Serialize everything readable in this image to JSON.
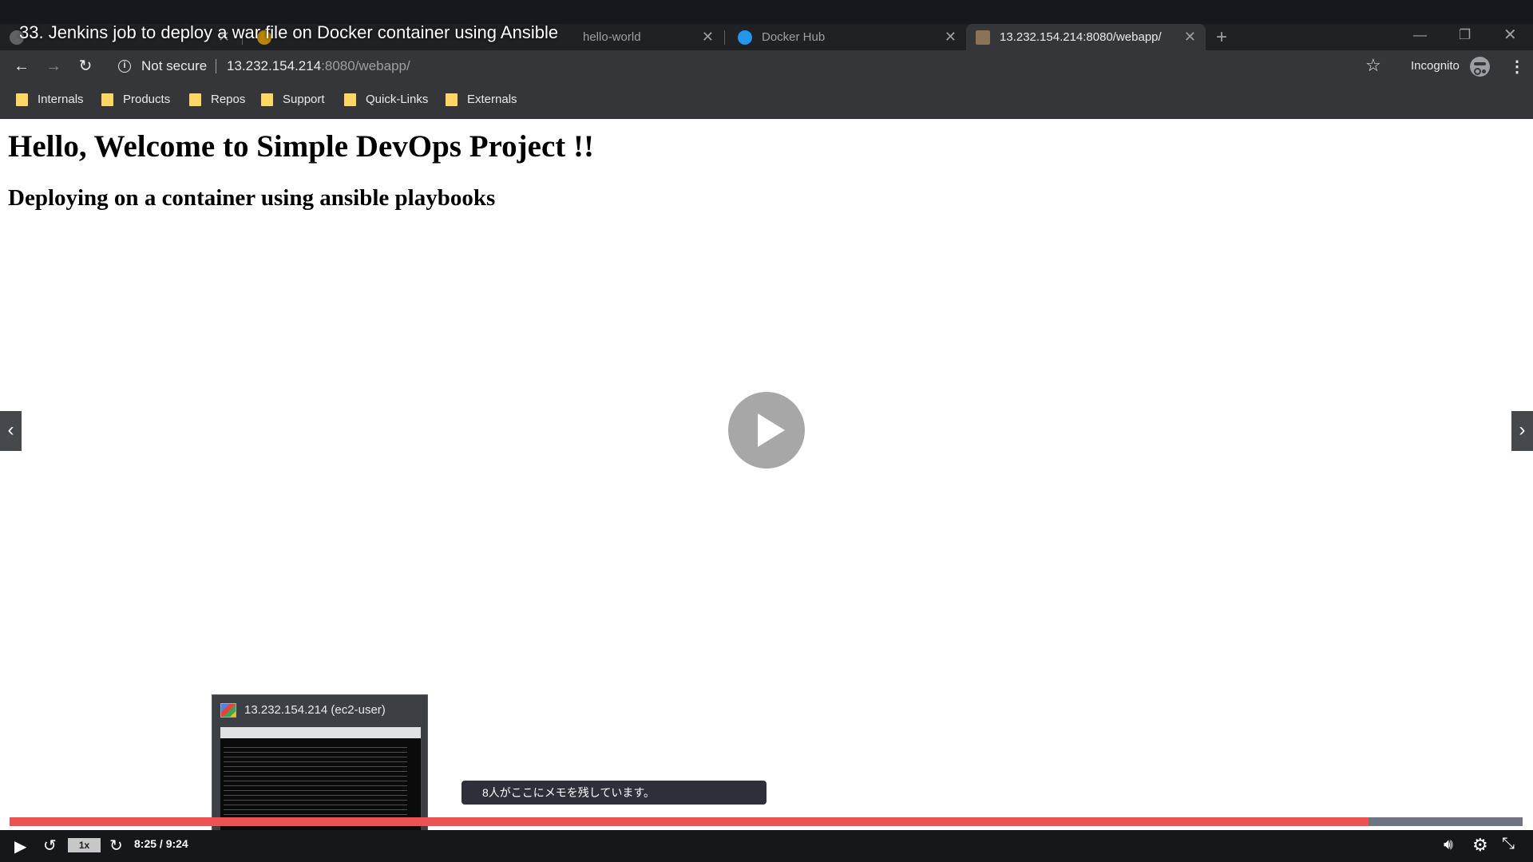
{
  "video": {
    "title": "33. Jenkins job to deploy a war file on Docker container using Ansible",
    "current_time": "8:25",
    "duration": "9:24",
    "time_display": "8:25 / 9:24",
    "speed": "1x",
    "progress": 0.898,
    "notes_tooltip": "8人がここにメモを残しています。",
    "thumbnail_title": "13.232.154.214 (ec2-user)"
  },
  "browser": {
    "tabs": [
      {
        "label": "hello-world",
        "active": false
      },
      {
        "label": "Docker Hub",
        "active": false
      },
      {
        "label": "13.232.154.214:8080/webapp/",
        "active": true
      }
    ],
    "security_label": "Not secure",
    "url_host": "13.232.154.214",
    "url_rest": ":8080/webapp/",
    "incognito_label": "Incognito",
    "bookmarks": [
      "Internals",
      "Products",
      "Repos",
      "Support",
      "Quick-Links",
      "Externals"
    ]
  },
  "page": {
    "heading": "Hello, Welcome to Simple DevOps Project !!",
    "subheading": "Deploying on a container using ansible playbooks"
  },
  "colors": {
    "progress_fill": "#ec5252",
    "bookmark_folder": "#fdd663",
    "chrome_dark": "#202124",
    "toolbar": "#35363a"
  }
}
